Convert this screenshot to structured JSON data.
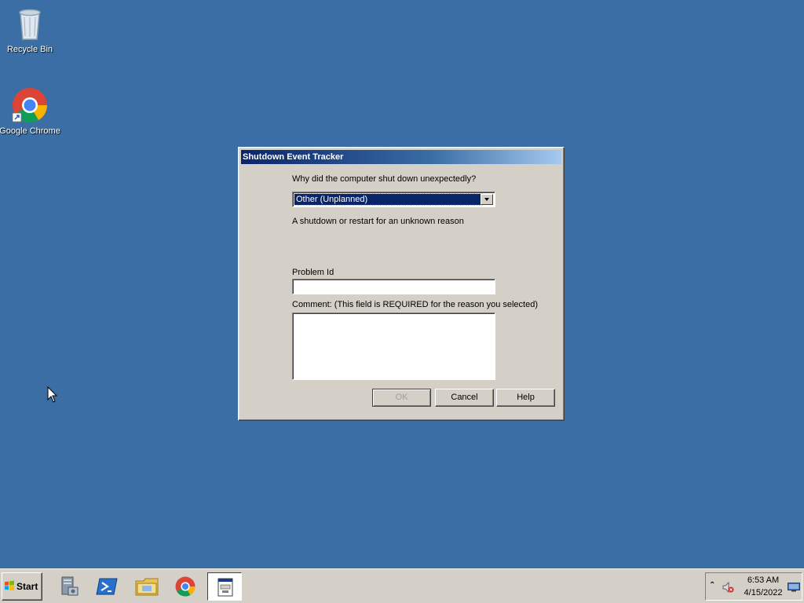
{
  "desktop": {
    "icons": [
      {
        "label": "Recycle Bin",
        "icon": "recycle-bin-icon"
      },
      {
        "label": "Google Chrome",
        "icon": "chrome-icon"
      }
    ]
  },
  "dialog": {
    "title": "Shutdown Event Tracker",
    "question": "Why did the computer shut down unexpectedly?",
    "reason_selected": "Other (Unplanned)",
    "reason_description": "A shutdown or restart for an unknown reason",
    "problem_id_label": "Problem Id",
    "problem_id_value": "",
    "comment_label": "Comment: (This field is REQUIRED for the reason you selected)",
    "comment_value": "",
    "buttons": {
      "ok": "OK",
      "cancel": "Cancel",
      "help": "Help"
    },
    "ok_enabled": false
  },
  "taskbar": {
    "start_label": "Start",
    "pinned": [
      {
        "icon": "server-manager-icon"
      },
      {
        "icon": "powershell-icon"
      },
      {
        "icon": "file-explorer-icon"
      },
      {
        "icon": "chrome-icon"
      },
      {
        "icon": "shutdown-tracker-icon",
        "active": true
      }
    ],
    "tray": {
      "time": "6:53 AM",
      "date": "4/15/2022",
      "expand_glyph": "⌃",
      "icons": [
        "volume-muted-icon",
        "show-desktop-icon"
      ]
    }
  },
  "colors": {
    "desktop": "#3a6ea5",
    "dialog_face": "#d4d0c8",
    "selection": "#0a246a",
    "title_gradient_start": "#0a246a",
    "title_gradient_end": "#a6caf0"
  }
}
